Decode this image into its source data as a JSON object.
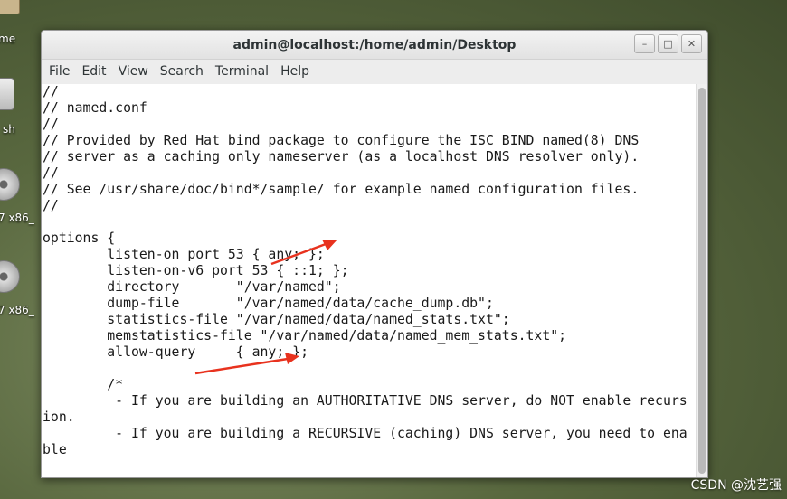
{
  "desktop": {
    "items": [
      {
        "label": "me",
        "icon": "folder-icon"
      },
      {
        "label": "sh",
        "icon": "trash-icon"
      },
      {
        "label": "7 x86_",
        "icon": "disc-icon"
      },
      {
        "label": "7 x86_",
        "icon": "disc-icon"
      }
    ]
  },
  "window": {
    "title": "admin@localhost:/home/admin/Desktop",
    "buttons": [
      {
        "name": "minimize-button",
        "glyph": "–"
      },
      {
        "name": "maximize-button",
        "glyph": "□"
      },
      {
        "name": "close-button",
        "glyph": "✕"
      }
    ]
  },
  "menu": [
    "File",
    "Edit",
    "View",
    "Search",
    "Terminal",
    "Help"
  ],
  "terminal": {
    "lines": [
      "//",
      "// named.conf",
      "//",
      "// Provided by Red Hat bind package to configure the ISC BIND named(8) DNS",
      "// server as a caching only nameserver (as a localhost DNS resolver only).",
      "//",
      "// See /usr/share/doc/bind*/sample/ for example named configuration files.",
      "//",
      "",
      "options {",
      "        listen-on port 53 { any; };",
      "        listen-on-v6 port 53 { ::1; };",
      "        directory       \"/var/named\";",
      "        dump-file       \"/var/named/data/cache_dump.db\";",
      "        statistics-file \"/var/named/data/named_stats.txt\";",
      "        memstatistics-file \"/var/named/data/named_mem_stats.txt\";",
      "        allow-query     { any; };",
      "",
      "        /*",
      "         - If you are building an AUTHORITATIVE DNS server, do NOT enable recurs",
      "ion.",
      "         - If you are building a RECURSIVE (caching) DNS server, you need to ena",
      "ble"
    ]
  },
  "annotation_color": "#e8321e",
  "watermark": "CSDN @沈艺强"
}
